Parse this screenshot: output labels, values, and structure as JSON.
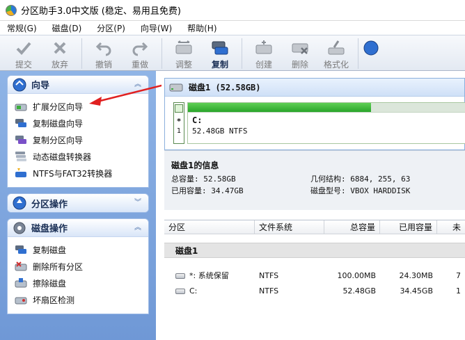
{
  "window": {
    "title": "分区助手3.0中文版 (稳定、易用且免费)"
  },
  "menu": [
    "常规(G)",
    "磁盘(D)",
    "分区(P)",
    "向导(W)",
    "帮助(H)"
  ],
  "toolbar": [
    {
      "label": "提交",
      "icon": "check-icon",
      "active": false
    },
    {
      "label": "放弃",
      "icon": "cross-icon",
      "active": false
    },
    {
      "label": "撤销",
      "icon": "undo-icon",
      "active": false
    },
    {
      "label": "重做",
      "icon": "redo-icon",
      "active": false
    },
    {
      "label": "调整",
      "icon": "resize-disk-icon",
      "active": false
    },
    {
      "label": "复制",
      "icon": "copy-disk-icon",
      "active": true
    },
    {
      "label": "创建",
      "icon": "create-partition-icon",
      "active": false
    },
    {
      "label": "删除",
      "icon": "delete-partition-icon",
      "active": false
    },
    {
      "label": "格式化",
      "icon": "format-icon",
      "active": false
    }
  ],
  "sidebar": {
    "wizard": {
      "title": "向导",
      "items": [
        {
          "label": "扩展分区向导",
          "icon": "extend-partition-icon"
        },
        {
          "label": "复制磁盘向导",
          "icon": "copy-disk-icon"
        },
        {
          "label": "复制分区向导",
          "icon": "copy-partition-icon"
        },
        {
          "label": "动态磁盘转换器",
          "icon": "dynamic-disk-icon"
        },
        {
          "label": "NTFS与FAT32转换器",
          "icon": "ntfs-fat32-icon"
        }
      ]
    },
    "partition_ops": {
      "title": "分区操作"
    },
    "disk_ops": {
      "title": "磁盘操作",
      "items": [
        {
          "label": "复制磁盘",
          "icon": "copy-disk-icon"
        },
        {
          "label": "删除所有分区",
          "icon": "delete-all-icon"
        },
        {
          "label": "擦除磁盘",
          "icon": "wipe-disk-icon"
        },
        {
          "label": "坏扇区检测",
          "icon": "bad-sector-icon"
        }
      ]
    }
  },
  "disk_card": {
    "title": "磁盘1 (52.58GB)",
    "slot_star": "*",
    "slot_num": "1",
    "partition_letter": "C:",
    "partition_info": "52.48GB NTFS",
    "used_fraction": 0.66
  },
  "disk_info": {
    "title": "磁盘1的信息",
    "total_label": "总容量: 52.58GB",
    "used_label": "已用容量: 34.47GB",
    "geometry_label": "几何结构: 6884, 255, 63",
    "model_label": "磁盘型号: VBOX HARDDISK"
  },
  "table": {
    "headers": [
      "分区",
      "文件系统",
      "总容量",
      "已用容量",
      "未"
    ],
    "group": "磁盘1",
    "rows": [
      {
        "name": "*: 系统保留",
        "fs": "NTFS",
        "total": "100.00MB",
        "used": "24.30MB",
        "free": "7"
      },
      {
        "name": "C:",
        "fs": "NTFS",
        "total": "52.48GB",
        "used": "34.45GB",
        "free": "1"
      }
    ]
  }
}
